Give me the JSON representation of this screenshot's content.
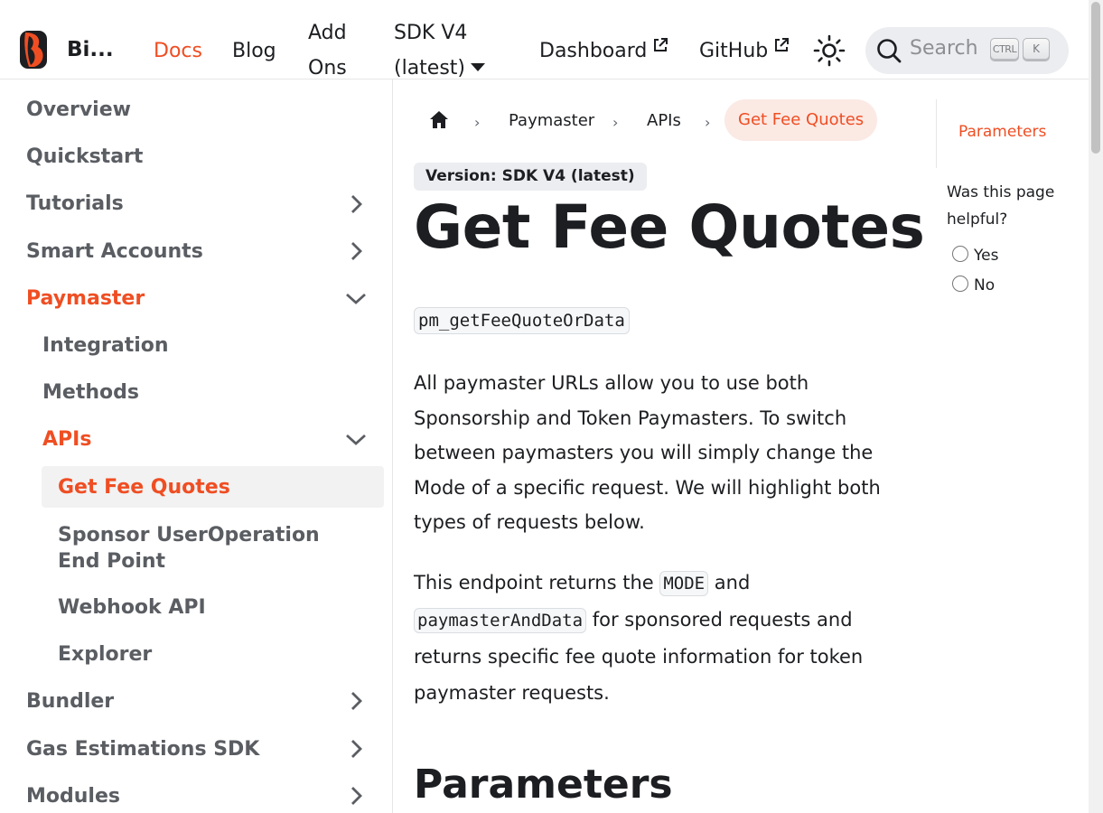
{
  "navbar": {
    "brand": "Bi...",
    "links": {
      "docs": "Docs",
      "blog": "Blog",
      "addons": "Add Ons",
      "sdk": "SDK V4 (latest)",
      "dashboard": "Dashboard",
      "github": "GitHub"
    },
    "search": {
      "placeholder": "Search",
      "shortcut_ctrl": "CTRL",
      "shortcut_key": "K"
    },
    "accent_color": "#ef4e23"
  },
  "sidebar": {
    "items": [
      {
        "label": "Overview"
      },
      {
        "label": "Quickstart"
      },
      {
        "label": "Tutorials"
      },
      {
        "label": "Smart Accounts"
      },
      {
        "label": "Paymaster"
      },
      {
        "label": "Integration"
      },
      {
        "label": "Methods"
      },
      {
        "label": "APIs"
      },
      {
        "label": "Get Fee Quotes"
      },
      {
        "label": "Sponsor UserOperation End Point"
      },
      {
        "label": "Webhook API"
      },
      {
        "label": "Explorer"
      },
      {
        "label": "Bundler"
      },
      {
        "label": "Gas Estimations SDK"
      },
      {
        "label": "Modules"
      }
    ]
  },
  "breadcrumbs": [
    "Paymaster",
    "APIs",
    "Get Fee Quotes"
  ],
  "main": {
    "version_badge": "Version: SDK V4 (latest)",
    "title": "Get Fee Quotes",
    "method": "pm_getFeeQuoteOrData",
    "paragraph1": "All paymaster URLs allow you to use both Sponsorship and Token Paymasters. To switch between paymasters you will simply change the Mode of a specific request. We will highlight both types of requests below.",
    "paragraph2": {
      "pre": "This endpoint returns the ",
      "code1": "MODE",
      "mid": " and ",
      "code2": "paymasterAndData",
      "post": " for sponsored requests and returns specific fee quote information for token paymaster requests."
    },
    "section_heading": "Parameters"
  },
  "toc": {
    "links": [
      "Parameters"
    ],
    "feedback_question": "Was this page helpful?",
    "options": [
      "Yes",
      "No"
    ]
  }
}
